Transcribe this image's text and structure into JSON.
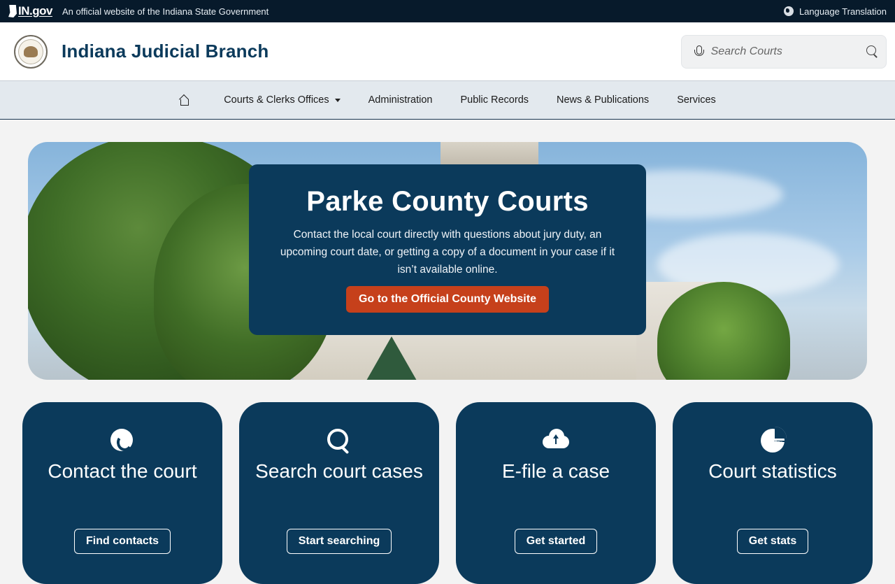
{
  "banner": {
    "logo_text": "IN.gov",
    "official_text": "An official website of the Indiana State Government",
    "language_label": "Language Translation"
  },
  "header": {
    "site_title": "Indiana Judicial Branch",
    "search_placeholder": "Search Courts"
  },
  "nav": {
    "items": [
      {
        "label": "Courts & Clerks Offices",
        "has_dropdown": true
      },
      {
        "label": "Administration"
      },
      {
        "label": "Public Records"
      },
      {
        "label": "News & Publications"
      },
      {
        "label": "Services"
      }
    ]
  },
  "hero": {
    "title": "Parke County Courts",
    "description": "Contact the local court directly with questions about jury duty, an upcoming court date, or getting a copy of a document in your case if it isn’t available online.",
    "button_label": "Go to the Official County Website"
  },
  "cards": [
    {
      "icon": "phone-icon",
      "title": "Contact the court",
      "button_label": "Find contacts"
    },
    {
      "icon": "search-icon",
      "title": "Search court cases",
      "button_label": "Start searching"
    },
    {
      "icon": "cloud-upload-icon",
      "title": "E-file a case",
      "button_label": "Get started"
    },
    {
      "icon": "pie-chart-icon",
      "title": "Court statistics",
      "button_label": "Get stats"
    }
  ],
  "colors": {
    "banner_bg": "#071a2b",
    "brand_navy": "#0b3a5b",
    "cta_orange": "#c6401b",
    "nav_bg": "#e3e9ee"
  }
}
